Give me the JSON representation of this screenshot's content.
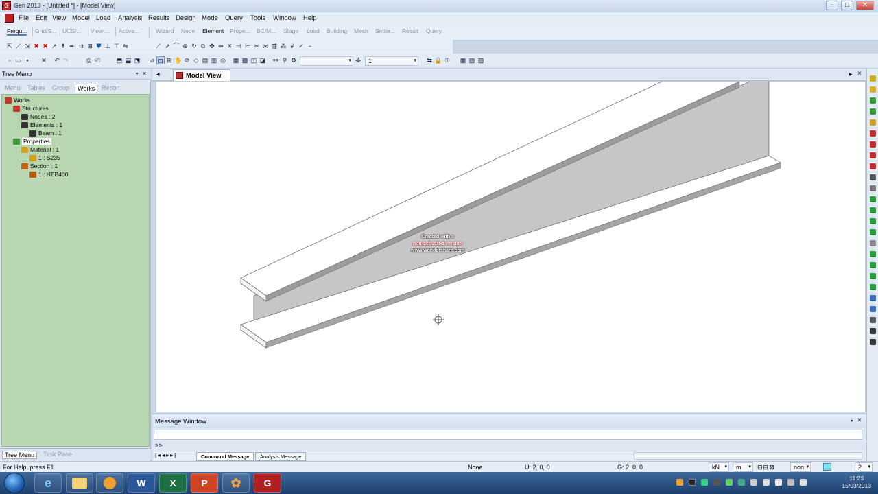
{
  "window": {
    "title": "Gen 2013 - [Untitled *] - [Model View]",
    "buttons": [
      "–",
      "□",
      "✕"
    ]
  },
  "menu": [
    "File",
    "Edit",
    "View",
    "Model",
    "Load",
    "Analysis",
    "Results",
    "Design",
    "Mode",
    "Query",
    "Tools",
    "Window",
    "Help"
  ],
  "toolbar": {
    "left_tabs": [
      "Frequ...",
      "Grid/S...",
      "UCS/...",
      "View ...",
      "Activa..."
    ],
    "main_tabs": [
      "Wizard",
      "Node",
      "Element",
      "Prope...",
      "BC/M...",
      "Stage",
      "Load",
      "Building",
      "Mesh",
      "Settle...",
      "Result",
      "Query"
    ],
    "active_main_tab": "Element",
    "combo_value": "1"
  },
  "left_panel": {
    "title": "Tree Menu",
    "tabs": [
      "Menu",
      "Tables",
      "Group",
      "Works",
      "Report"
    ],
    "active_tab": "Works",
    "tree": [
      {
        "label": "Works",
        "level": 0,
        "icon": "works-icon"
      },
      {
        "label": "Structures",
        "level": 1,
        "icon": "structures-icon"
      },
      {
        "label": "Nodes : 2",
        "level": 2,
        "icon": "nodes-icon"
      },
      {
        "label": "Elements : 1",
        "level": 2,
        "icon": "elements-icon"
      },
      {
        "label": "Beam : 1",
        "level": 3,
        "icon": "beam-icon"
      },
      {
        "label": "Properties",
        "level": 1,
        "icon": "properties-icon"
      },
      {
        "label": "Material : 1",
        "level": 2,
        "icon": "material-icon"
      },
      {
        "label": "1 : S235",
        "level": 3,
        "icon": "material-item-icon"
      },
      {
        "label": "Section : 1",
        "level": 2,
        "icon": "section-icon"
      },
      {
        "label": "1 : HEB400",
        "level": 3,
        "icon": "section-item-icon"
      }
    ],
    "footer_tabs": [
      "Tree Menu",
      "Task Pane"
    ]
  },
  "model_view": {
    "tab_label": "Model View",
    "watermark": [
      "Created with a",
      "non-activated version",
      "www.wondershare.com"
    ]
  },
  "message_window": {
    "title": "Message Window",
    "prompt": ">>",
    "tabs": [
      "Command Message",
      "Analysis Message"
    ]
  },
  "status": {
    "help": "For Help, press F1",
    "selection": "None",
    "u_coords": "U: 2, 0, 0",
    "g_coords": "G: 2, 0, 0",
    "force_unit": "kN",
    "length_unit": "m",
    "extra_unit": "non",
    "page": "2"
  },
  "taskbar": {
    "time": "11:23",
    "date": "15/03/2013",
    "apps": [
      "W",
      "X",
      "P",
      "G"
    ]
  },
  "colors": {
    "tree_bg": "#b8d7b0",
    "beam_web": "#c8c5c8",
    "beam_flange": "#ffffff",
    "beam_edge": "#6e6e6e"
  }
}
